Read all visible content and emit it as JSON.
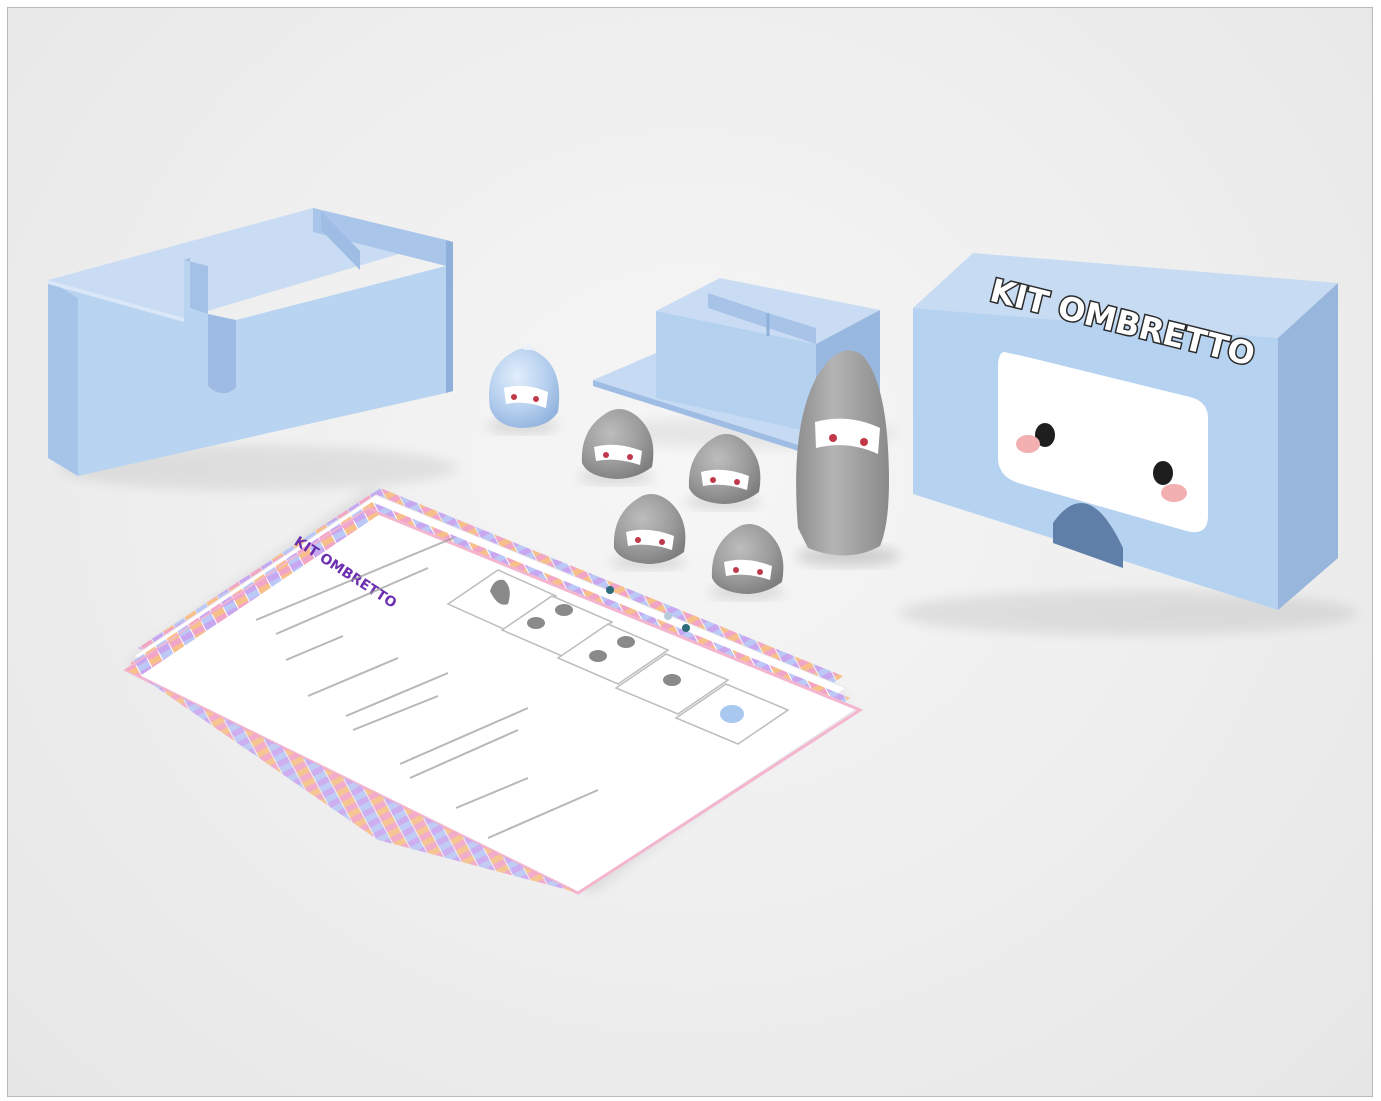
{
  "image": {
    "kind": "3D product render",
    "box_label": "KIT OMBRETTO",
    "card_title": "KIT OMBRETTO"
  },
  "colors": {
    "background": "#efefef",
    "box_blue": "#b8d4f1",
    "box_blue_dark": "#97b7dc",
    "figure_gray": "#9a9a9a",
    "card_pink": "#f2a6c7",
    "card_purple": "#c9a7f0",
    "card_orange": "#f7c08a"
  },
  "objects": [
    "card-holder-box",
    "small-tray",
    "lidded-box",
    "blue-pawn",
    "gray-pawn",
    "tall-gray-figure",
    "instruction-cards"
  ]
}
